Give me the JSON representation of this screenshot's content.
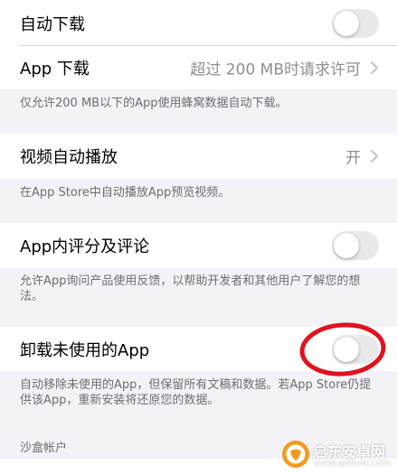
{
  "rows": {
    "auto_download": {
      "label": "自动下载",
      "toggle_on": false
    },
    "app_download": {
      "label": "App 下载",
      "value": "超过 200 MB时请求许可"
    },
    "app_download_footer": "仅允许200 MB以下的App使用蜂窝数据自动下载。",
    "video_autoplay": {
      "label": "视频自动播放",
      "value": "开"
    },
    "video_autoplay_footer": "在App Store中自动播放App预览视频。",
    "ratings_reviews": {
      "label": "App内评分及评论",
      "toggle_on": false
    },
    "ratings_reviews_footer": "允许App询问产品使用反馈，以帮助开发者和其他用户了解您的想法。",
    "offload_apps": {
      "label": "卸载未使用的App",
      "toggle_on": false
    },
    "offload_apps_footer": "自动移除未使用的App，但保留所有文稿和数据。若App Store仍提供该App，重新安装将还原您的数据。",
    "sandbox_header": "沙盒帐户"
  },
  "colors": {
    "background": "#f2f2f7",
    "cell": "#ffffff",
    "secondary_text": "#8e8e93",
    "footer_text": "#6d6d72",
    "toggle_off": "#e9e9eb",
    "annotation": "#e0121e",
    "watermark_orange": "#f39a1e"
  },
  "watermark": {
    "name": "启东安卓网",
    "url": "www.qdfuns.com"
  }
}
